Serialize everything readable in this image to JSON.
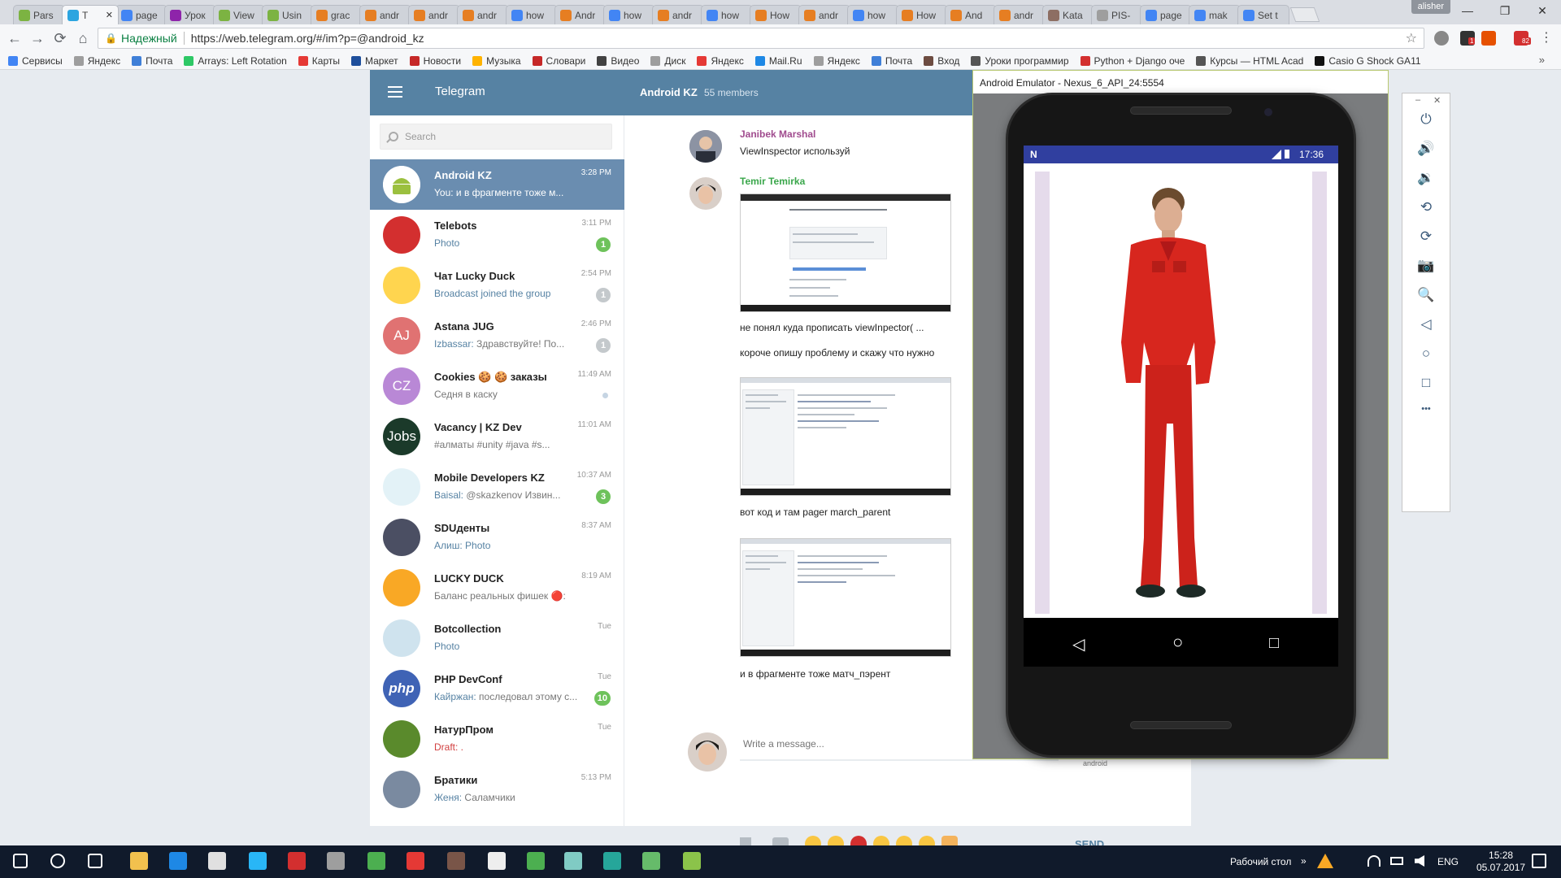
{
  "browser": {
    "tabs": [
      {
        "label": "Pars",
        "color": "#7cb342"
      },
      {
        "label": "T",
        "color": "#2ca5e0",
        "active": true
      },
      {
        "label": "page",
        "color": "#4285f4"
      },
      {
        "label": "Урок",
        "color": "#8e24aa"
      },
      {
        "label": "View",
        "color": "#7cb342"
      },
      {
        "label": "Usin",
        "color": "#7cb342"
      },
      {
        "label": "grac",
        "color": "#e67e22"
      },
      {
        "label": "andr",
        "color": "#e67e22"
      },
      {
        "label": "andr",
        "color": "#e67e22"
      },
      {
        "label": "andr",
        "color": "#e67e22"
      },
      {
        "label": "how",
        "color": "#4285f4"
      },
      {
        "label": "Andr",
        "color": "#e67e22"
      },
      {
        "label": "how",
        "color": "#4285f4"
      },
      {
        "label": "andr",
        "color": "#e67e22"
      },
      {
        "label": "how",
        "color": "#4285f4"
      },
      {
        "label": "How",
        "color": "#e67e22"
      },
      {
        "label": "andr",
        "color": "#e67e22"
      },
      {
        "label": "how",
        "color": "#4285f4"
      },
      {
        "label": "How",
        "color": "#e67e22"
      },
      {
        "label": "And",
        "color": "#e67e22"
      },
      {
        "label": "andr",
        "color": "#e67e22"
      },
      {
        "label": "Kata",
        "color": "#8d6e63"
      },
      {
        "label": "PIS-",
        "color": "#9e9e9e"
      },
      {
        "label": "page",
        "color": "#4285f4"
      },
      {
        "label": "mak",
        "color": "#4285f4"
      },
      {
        "label": "Set t",
        "color": "#4285f4"
      }
    ],
    "tab_close_glyph": "✕",
    "profile_name": "alisher",
    "window_controls": {
      "minimize": "—",
      "restore": "❐",
      "close": "✕"
    },
    "nav": {
      "back": "←",
      "forward": "→",
      "reload": "⟳",
      "home": "⌂"
    },
    "secure_label": "Надежный",
    "url": "https://web.telegram.org/#/im?p=@android_kz",
    "bookmark_star": "☆",
    "extension_badges": [
      "1",
      "82"
    ],
    "bookmarks": [
      {
        "label": "Сервисы",
        "color": "#4285f4"
      },
      {
        "label": "Яндекс",
        "color": "#9e9e9e"
      },
      {
        "label": "Почта",
        "color": "#3f7fd8"
      },
      {
        "label": "Arrays: Left Rotation",
        "color": "#2ec866"
      },
      {
        "label": "Карты",
        "color": "#e53935"
      },
      {
        "label": "Маркет",
        "color": "#1e4f9c"
      },
      {
        "label": "Новости",
        "color": "#c62828"
      },
      {
        "label": "Музыка",
        "color": "#ffb300"
      },
      {
        "label": "Словари",
        "color": "#c62828"
      },
      {
        "label": "Видео",
        "color": "#424242"
      },
      {
        "label": "Диск",
        "color": "#9e9e9e"
      },
      {
        "label": "Яндекс",
        "color": "#e53935"
      },
      {
        "label": "Mail.Ru",
        "color": "#1e88e5"
      },
      {
        "label": "Яндекс",
        "color": "#9e9e9e"
      },
      {
        "label": "Почта",
        "color": "#3f7fd8"
      },
      {
        "label": "Вход",
        "color": "#6d4c41"
      },
      {
        "label": "Уроки программир",
        "color": "#555555"
      },
      {
        "label": "Python + Django оче",
        "color": "#d32f2f"
      },
      {
        "label": "Курсы — HTML Acad",
        "color": "#555555"
      },
      {
        "label": "Casio G Shock GA11",
        "color": "#111111"
      }
    ],
    "bookmarks_more": "»"
  },
  "telegram": {
    "brand": "Telegram",
    "chat_title": "Android KZ",
    "members": "55 members",
    "search_placeholder": "Search",
    "dialogs": [
      {
        "name": "Android KZ",
        "time": "3:28 PM",
        "preview": "You: и в фрагменте тоже м...",
        "preview_style": "",
        "avatar_text": "",
        "avatar_color": "#ffffff",
        "active": true,
        "badge": "",
        "badge_style": ""
      },
      {
        "name": "Telebots",
        "time": "3:11 PM",
        "preview": "Photo",
        "preview_style": "blue",
        "avatar_text": "",
        "avatar_color": "#d32f2f",
        "badge": "1",
        "badge_style": "green"
      },
      {
        "name": "Чат Lucky Duck",
        "time": "2:54 PM",
        "preview": "Broadcast joined the group",
        "preview_style": "blue",
        "avatar_text": "",
        "avatar_color": "#ffd54f",
        "badge": "1",
        "badge_style": "grey"
      },
      {
        "name": "Astana JUG",
        "time": "2:46 PM",
        "sender": "Izbassar:",
        "preview": "Здравствуйте! По...",
        "preview_style": "",
        "avatar_text": "AJ",
        "avatar_color": "#e07272",
        "badge": "1",
        "badge_style": "grey"
      },
      {
        "name": "Cookies 🍪 🍪 заказы",
        "time": "11:49 AM",
        "preview": "Седня в каску",
        "preview_style": "",
        "avatar_text": "CZ",
        "avatar_color": "#b988d6",
        "badge": "",
        "badge_style": "dot"
      },
      {
        "name": "Vacancy | KZ Dev",
        "time": "11:01 AM",
        "preview": "#алматы #unity #java #s...",
        "preview_style": "",
        "avatar_text": "Jobs",
        "avatar_color": "#1b3a2a",
        "badge": "",
        "badge_style": ""
      },
      {
        "name": "Mobile Developers KZ",
        "time": "10:37 AM",
        "sender": "Baisal:",
        "preview": "@skazkenov Извин...",
        "preview_style": "",
        "avatar_text": "",
        "avatar_color": "#e3f2f7",
        "badge": "3",
        "badge_style": "green"
      },
      {
        "name": "SDUденты",
        "time": "8:37 AM",
        "sender": "Алиш:",
        "preview": "Photo",
        "preview_style": "blue",
        "avatar_text": "",
        "avatar_color": "#4b4f63",
        "badge": "",
        "badge_style": ""
      },
      {
        "name": "LUCKY DUCK",
        "time": "8:19 AM",
        "preview": "Баланс реальных фишек 🔴:",
        "preview_style": "",
        "avatar_text": "",
        "avatar_color": "#f9a825",
        "badge": "",
        "badge_style": ""
      },
      {
        "name": "Botcollection",
        "time": "Tue",
        "preview": "Photo",
        "preview_style": "blue",
        "avatar_text": "",
        "avatar_color": "#cfe3ee",
        "badge": "",
        "badge_style": ""
      },
      {
        "name": "PHP DevConf",
        "time": "Tue",
        "sender": "Кайржан:",
        "preview": "последовал этому с...",
        "preview_style": "",
        "avatar_text": "php",
        "avatar_color": "#3f63b5",
        "badge": "10",
        "badge_style": "green"
      },
      {
        "name": "НатурПром",
        "time": "Tue",
        "preview": "Draft: .",
        "preview_style": "red",
        "avatar_text": "",
        "avatar_color": "#5a8a2c",
        "badge": "",
        "badge_style": ""
      },
      {
        "name": "Братики",
        "time": "5:13 PM",
        "sender": "Женя:",
        "preview": "Саламчики",
        "preview_style": "",
        "avatar_text": "",
        "avatar_color": "#7a8aa0",
        "badge": "",
        "badge_style": ""
      }
    ],
    "messages": {
      "m1": {
        "author": "Janibek Marshal",
        "author_color": "#a04b8e",
        "text": "ViewInspector используй"
      },
      "m2": {
        "author": "Temir Temirka",
        "author_color": "#3aa74b"
      },
      "t1": "не понял куда прописать viewInpector( ...",
      "t2": "короче опишу проблему и скажу что нужно",
      "t3": "вот код и там pager march_parent",
      "t4": "и в фрагменте тоже матч_пэрент"
    },
    "composer_placeholder": "Write a message...",
    "send_label": "SEND",
    "peek_text": "android"
  },
  "emulator": {
    "title": "Android Emulator - Nexus_6_API_24:5554",
    "status_time": "17:36",
    "notification_glyph": "N",
    "nav_keys": {
      "back": "◁",
      "home": "○",
      "recents": "□"
    },
    "window_controls": {
      "minimize": "–",
      "close": "✕"
    },
    "controls": [
      {
        "name": "power-icon",
        "glyph": "⏻"
      },
      {
        "name": "volume-up-icon",
        "glyph": "🔊"
      },
      {
        "name": "volume-down-icon",
        "glyph": "🔉"
      },
      {
        "name": "rotate-left-icon",
        "glyph": "⟲"
      },
      {
        "name": "rotate-right-icon",
        "glyph": "⟳"
      },
      {
        "name": "camera-icon",
        "glyph": "📷"
      },
      {
        "name": "zoom-icon",
        "glyph": "🔍"
      },
      {
        "name": "back-icon",
        "glyph": "◁"
      },
      {
        "name": "home-icon",
        "glyph": "○"
      },
      {
        "name": "overview-icon",
        "glyph": "□"
      },
      {
        "name": "more-icon",
        "glyph": "•••"
      }
    ]
  },
  "taskbar": {
    "desktop_label": "Рабочий стол",
    "lang": "ENG",
    "time": "15:28",
    "date": "05.07.2017",
    "tray_more": "»",
    "apps": [
      {
        "name": "start-icon",
        "color": "#ffffff"
      },
      {
        "name": "search-icon",
        "color": "#ffffff"
      },
      {
        "name": "task-view-icon",
        "color": "#ffffff"
      },
      {
        "name": "explorer-icon",
        "color": "#f2c14e"
      },
      {
        "name": "edge-icon",
        "color": "#1e88e5"
      },
      {
        "name": "file-icon",
        "color": "#e0e0e0"
      },
      {
        "name": "store-icon",
        "color": "#29b6f6"
      },
      {
        "name": "power-app-icon",
        "color": "#d32f2f"
      },
      {
        "name": "app-icon",
        "color": "#9e9e9e"
      },
      {
        "name": "chrome-icon",
        "color": "#4caf50"
      },
      {
        "name": "pen-icon",
        "color": "#e53935"
      },
      {
        "name": "media-icon",
        "color": "#795548"
      },
      {
        "name": "calculator-icon",
        "color": "#eeeeee"
      },
      {
        "name": "notepad-icon",
        "color": "#4caf50"
      },
      {
        "name": "tool-icon",
        "color": "#80cbc4"
      },
      {
        "name": "pycharm-icon",
        "color": "#26a69a"
      },
      {
        "name": "android-studio-icon",
        "color": "#66bb6a"
      },
      {
        "name": "emulator-icon",
        "color": "#8bc34a"
      }
    ]
  }
}
